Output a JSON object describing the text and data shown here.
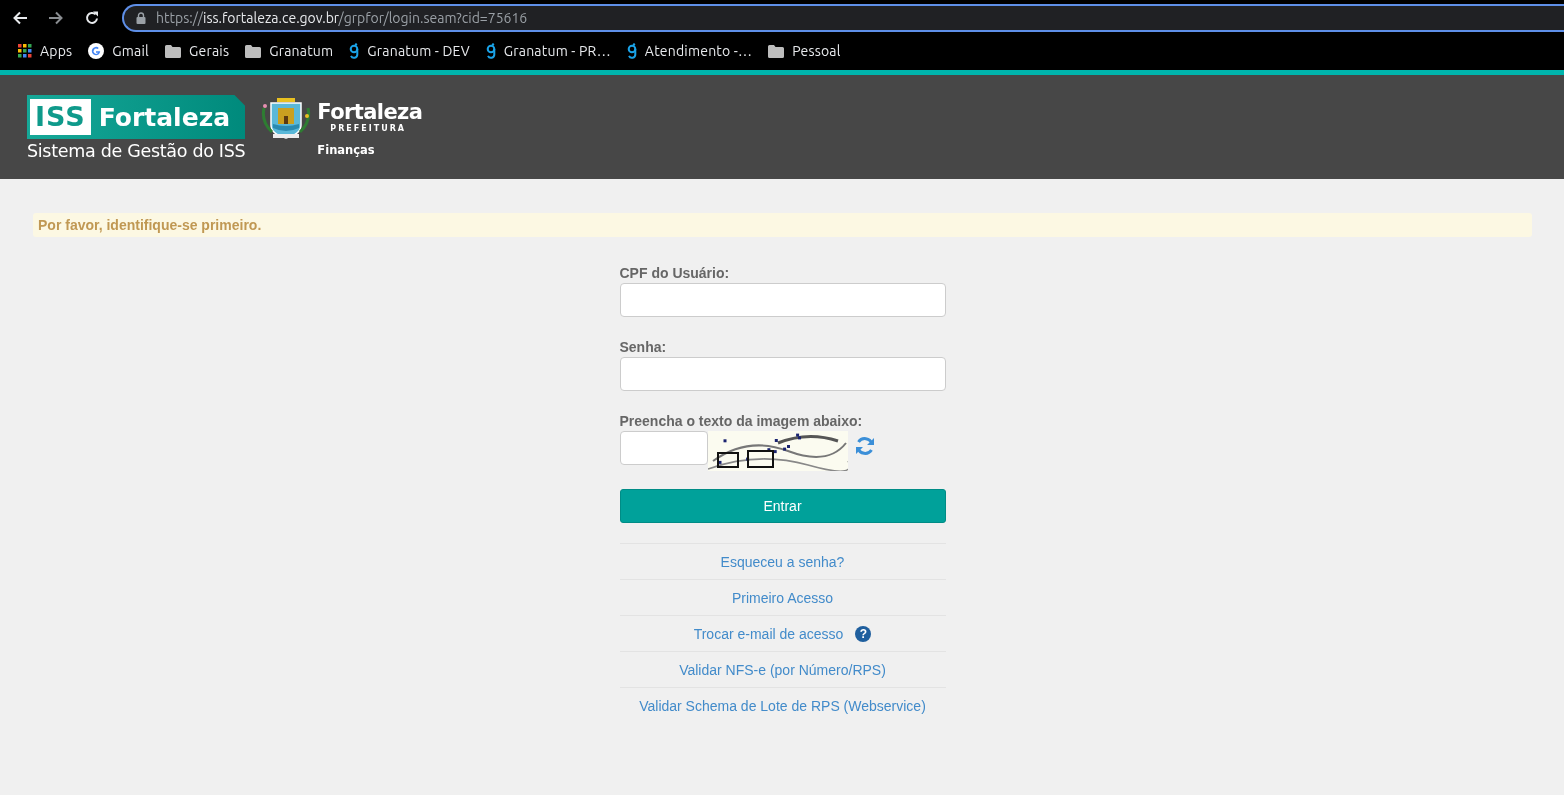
{
  "browser": {
    "url": {
      "scheme": "https://",
      "host": "iss.fortaleza.ce.gov.br",
      "path": "/grpfor/login.seam?cid=75616"
    },
    "bookmarks": [
      {
        "kind": "apps",
        "label": "Apps"
      },
      {
        "kind": "google",
        "label": "Gmail"
      },
      {
        "kind": "folder",
        "label": "Gerais"
      },
      {
        "kind": "folder",
        "label": "Granatum"
      },
      {
        "kind": "granatum",
        "label": "Granatum - DEV"
      },
      {
        "kind": "granatum",
        "label": "Granatum - PR…"
      },
      {
        "kind": "granatum",
        "label": "Atendimento -…"
      },
      {
        "kind": "folder",
        "label": "Pessoal"
      }
    ]
  },
  "header": {
    "iss_logo": {
      "badge": "ISS",
      "name": "Fortaleza",
      "subtitle": "Sistema de Gestão do ISS"
    },
    "city_logo": {
      "name": "Fortaleza",
      "tag": "PREFEITURA",
      "department": "Finanças"
    }
  },
  "alert": "Por favor, identifique-se primeiro.",
  "form": {
    "fields": [
      {
        "kind": "text",
        "label": "CPF do Usuário:"
      },
      {
        "kind": "password",
        "label": "Senha:"
      },
      {
        "kind": "captcha",
        "label": "Preencha o texto da imagem abaixo:"
      }
    ],
    "submit": "Entrar",
    "links": [
      {
        "label": "Esqueceu a senha?"
      },
      {
        "label": "Primeiro Acesso"
      },
      {
        "label": "Trocar e-mail de acesso",
        "help": "?"
      },
      {
        "label": "Validar NFS-e (por Número/RPS)"
      },
      {
        "label": "Validar Schema de Lote de RPS (Webservice)"
      }
    ]
  }
}
